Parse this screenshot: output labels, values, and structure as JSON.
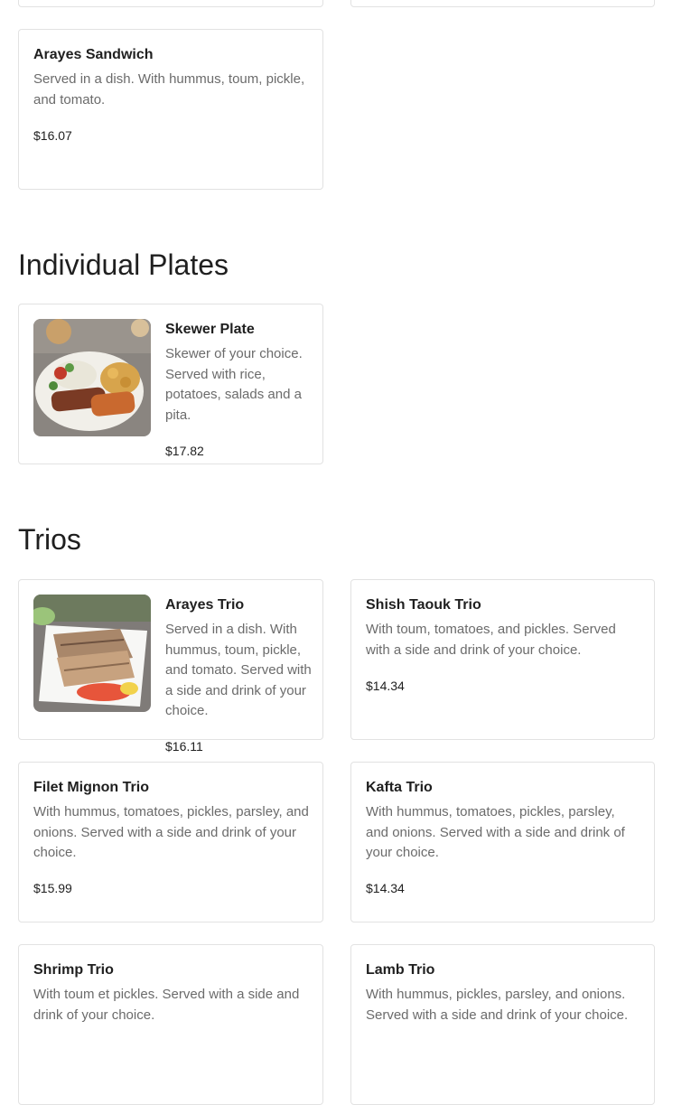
{
  "sandwiches": {
    "arayes_sandwich": {
      "title": "Arayes Sandwich",
      "description": "Served in a dish. With hummus, toum, pickle, and tomato.",
      "price": "$16.07"
    }
  },
  "individual_plates": {
    "heading": "Individual Plates",
    "skewer_plate": {
      "title": "Skewer Plate",
      "description": "Skewer of your choice. Served with rice, potatoes, salads and a pita.",
      "price": "$17.82"
    }
  },
  "trios": {
    "heading": "Trios",
    "arayes_trio": {
      "title": "Arayes Trio",
      "description": "Served in a dish. With hummus, toum, pickle, and tomato. Served with a side and drink of your choice.",
      "price": "$16.11"
    },
    "shish_taouk_trio": {
      "title": "Shish Taouk Trio",
      "description": "With toum, tomatoes, and pickles. Served with a side and drink of your choice.",
      "price": "$14.34"
    },
    "filet_mignon_trio": {
      "title": "Filet Mignon Trio",
      "description": "With hummus, tomatoes, pickles, parsley, and onions. Served with a side and drink of your choice.",
      "price": "$15.99"
    },
    "kafta_trio": {
      "title": "Kafta Trio",
      "description": "With hummus, tomatoes, pickles, parsley, and onions. Served with a side and drink of your choice.",
      "price": "$14.34"
    },
    "shrimp_trio": {
      "title": "Shrimp Trio",
      "description": "With toum et pickles. Served with a side and drink of your choice."
    },
    "lamb_trio": {
      "title": "Lamb Trio",
      "description": "With hummus, pickles, parsley, and onions. Served with a side and drink of your choice."
    }
  }
}
